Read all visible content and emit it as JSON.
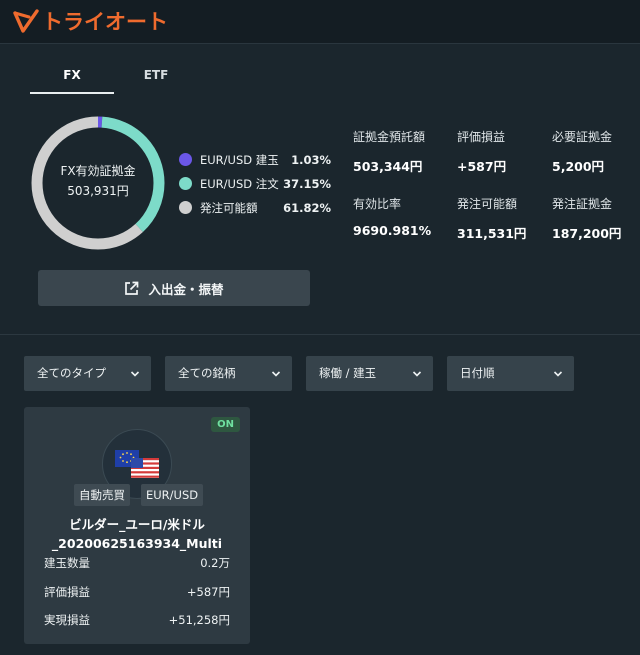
{
  "app": {
    "logo_text": "トライオート",
    "brand_color": "#ef6b2e"
  },
  "tabs": [
    {
      "label": "FX",
      "active": true
    },
    {
      "label": "ETF",
      "active": false
    }
  ],
  "summary": {
    "donut_title": "FX有効証拠金",
    "donut_value": "503,931円",
    "legend": [
      {
        "label": "EUR/USD 建玉",
        "pct": "1.03%",
        "color": "#6b57e8",
        "fraction": 0.0103
      },
      {
        "label": "EUR/USD 注文",
        "pct": "37.15%",
        "color": "#7ddbc9",
        "fraction": 0.3715
      },
      {
        "label": "発注可能額",
        "pct": "61.82%",
        "color": "#cfcfcf",
        "fraction": 0.6182
      }
    ],
    "stats": [
      {
        "label": "証拠金預託額",
        "value": "503,344円"
      },
      {
        "label": "評価損益",
        "value": "+587円"
      },
      {
        "label": "必要証拠金",
        "value": "5,200円"
      },
      {
        "label": "有効比率",
        "value": "9690.981%"
      },
      {
        "label": "発注可能額",
        "value": "311,531円"
      },
      {
        "label": "発注証拠金",
        "value": "187,200円"
      }
    ],
    "transfer_button": "入出金・振替"
  },
  "filters": [
    {
      "label": "全てのタイプ"
    },
    {
      "label": "全ての銘柄"
    },
    {
      "label": "稼働 / 建玉"
    },
    {
      "label": "日付順"
    }
  ],
  "card": {
    "status": "ON",
    "tags": [
      "自動売買",
      "EUR/USD"
    ],
    "title_line1": "ビルダー_ユーロ/米ドル",
    "title_line2": "_20200625163934_Multi",
    "rows": [
      {
        "label": "建玉数量",
        "value": "0.2万"
      },
      {
        "label": "評価損益",
        "value": "+587円"
      },
      {
        "label": "実現損益",
        "value": "+51,258円"
      }
    ]
  }
}
